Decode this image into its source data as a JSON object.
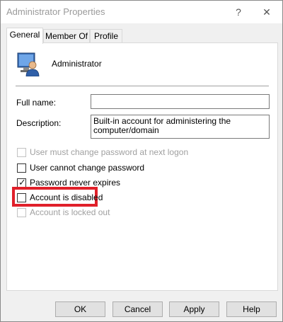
{
  "window": {
    "title": "Administrator Properties",
    "help_glyph": "?",
    "close_glyph": "✕"
  },
  "tabs": [
    {
      "label": "General",
      "active": true
    },
    {
      "label": "Member Of",
      "active": false
    },
    {
      "label": "Profile",
      "active": false
    }
  ],
  "general": {
    "user_icon": "user-account-icon",
    "user_name": "Administrator",
    "full_name_label": "Full name:",
    "full_name_value": "",
    "description_label": "Description:",
    "description_value": "Built-in account for administering the computer/domain",
    "options": [
      {
        "label": "User must change password at next logon",
        "checked": false,
        "enabled": false
      },
      {
        "label": "User cannot change password",
        "checked": false,
        "enabled": true
      },
      {
        "label": "Password never expires",
        "checked": true,
        "enabled": true
      },
      {
        "label": "Account is disabled",
        "checked": false,
        "enabled": true,
        "highlighted": true
      },
      {
        "label": "Account is locked out",
        "checked": false,
        "enabled": false
      }
    ],
    "check_glyph": "✓"
  },
  "buttons": {
    "ok": "OK",
    "cancel": "Cancel",
    "apply": "Apply",
    "help": "Help"
  },
  "colors": {
    "highlight": "#e0202a",
    "disabled_text": "#a0a0a0"
  }
}
